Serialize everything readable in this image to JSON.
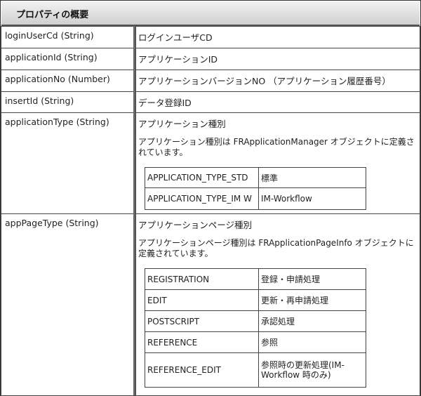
{
  "header": {
    "title": "プロパティの概要"
  },
  "rows": [
    {
      "name": "loginUserCd (String)",
      "desc": "ログインユーザCD"
    },
    {
      "name": "applicationId (String)",
      "desc": "アプリケーションID"
    },
    {
      "name": "applicationNo (Number)",
      "desc": "アプリケーションバージョンNO （アプリケーション履歴番号）"
    },
    {
      "name": "insertId (String)",
      "desc": "データ登録ID"
    },
    {
      "name": "applicationType (String)",
      "desc": "アプリケーション種別",
      "note": "アプリケーション種別は FRApplicationManager オブジェクトに定義されています。",
      "items": [
        {
          "key": "APPLICATION_TYPE_STD",
          "value": "標準"
        },
        {
          "key": "APPLICATION_TYPE_IM W",
          "value": "IM-Workflow"
        }
      ]
    },
    {
      "name": "appPageType (String)",
      "desc": "アプリケーションページ種別",
      "note": "アプリケーションページ種別は FRApplicationPageInfo オブジェクトに定義されています。",
      "items": [
        {
          "key": "REGISTRATION",
          "value": "登録・申請処理"
        },
        {
          "key": "EDIT",
          "value": "更新・再申請処理"
        },
        {
          "key": "POSTSCRIPT",
          "value": "承認処理"
        },
        {
          "key": "REFERENCE",
          "value": "参照"
        },
        {
          "key": "REFERENCE_EDIT",
          "value": "参照時の更新処理(IM-Workflow 時のみ)"
        }
      ]
    }
  ]
}
